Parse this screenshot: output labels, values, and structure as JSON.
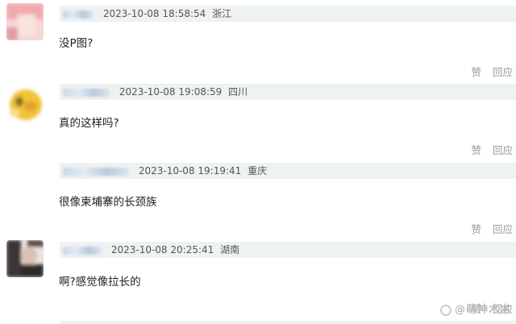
{
  "comments": [
    {
      "time": "2023-10-08 18:58:54",
      "location": "浙江",
      "text": "没P图?",
      "like_label": "赞",
      "reply_label": "回应"
    },
    {
      "time": "2023-10-08 19:08:59",
      "location": "四川",
      "text": "真的这样吗?",
      "like_label": "赞",
      "reply_label": "回应"
    },
    {
      "time": "2023-10-08 19:19:41",
      "location": "重庆",
      "text": "很像柬埔寨的长颈族",
      "like_label": "赞",
      "reply_label": "回应"
    },
    {
      "time": "2023-10-08 20:25:41",
      "location": "湖南",
      "text": "啊?感觉像拉长的",
      "like_label": "赞",
      "reply_label": "回应"
    }
  ],
  "watermark": {
    "text": "@萌神木木",
    "icon": "camera-icon"
  }
}
